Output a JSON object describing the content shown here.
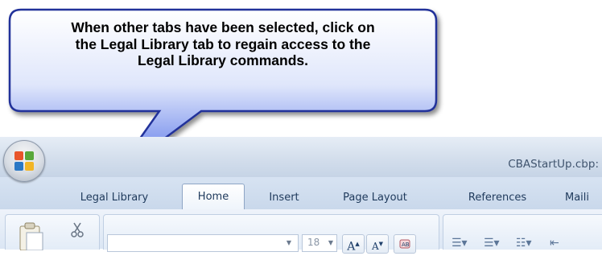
{
  "callout": {
    "line1": "When other tabs have been selected, click on",
    "line2": "the Legal Library tab to regain access to the",
    "line3": "Legal Library commands.",
    "fill_top": "#ffffff",
    "fill_bottom": "#4b6ae6",
    "border": "#20309a"
  },
  "window": {
    "title": "CBAStartUp.cbp:"
  },
  "tabs": [
    {
      "label": "Legal Library",
      "active": false
    },
    {
      "label": "Home",
      "active": true
    },
    {
      "label": "Insert",
      "active": false
    },
    {
      "label": "Page Layout",
      "active": false
    },
    {
      "label": "References",
      "active": false
    },
    {
      "label": "Maili",
      "active": false
    }
  ],
  "ribbon": {
    "font_size": "18",
    "grow_font_label": "A",
    "shrink_font_label": "A"
  },
  "icons": [
    "office-button-icon",
    "paste-icon",
    "cut-icon",
    "dropdown-arrow-icon",
    "grow-font-icon",
    "shrink-font-icon",
    "clear-format-icon",
    "bullets-icon",
    "numbering-icon",
    "multilevel-list-icon",
    "decrease-indent-icon"
  ]
}
